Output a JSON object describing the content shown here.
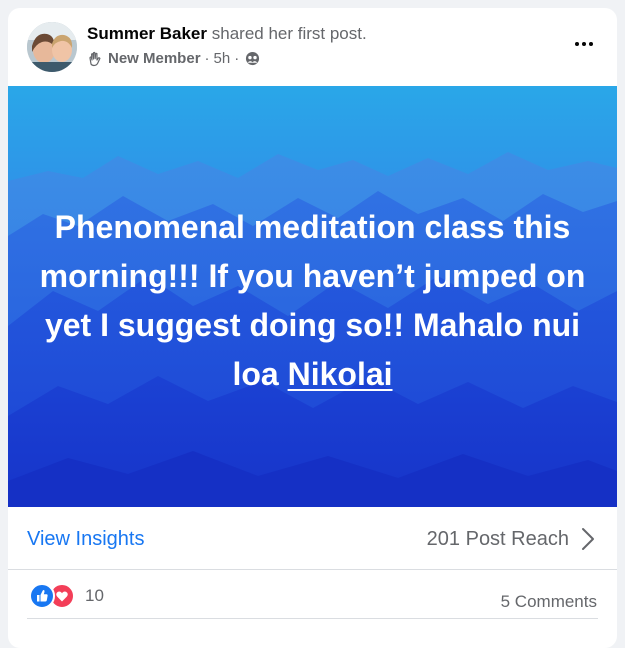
{
  "post": {
    "author": "Summer Baker",
    "action": "shared her first post.",
    "badge": "New Member",
    "time": "5h",
    "dot": "·",
    "audience_icon": "group-audience-icon",
    "badge_icon": "waving-hand-icon",
    "more_icon": "more-options-icon"
  },
  "media": {
    "text_before_link": "Phenomenal meditation class this morning!!! If you haven’t jumped on yet I suggest doing so!! Mahalo nui loa ",
    "link_text": "Nikolai",
    "background": "blue-mountains",
    "colors": {
      "sky_top": "#23a8e6",
      "sky_bottom": "#1a4fd8",
      "text": "#ffffff"
    }
  },
  "insights": {
    "view_label": "View Insights",
    "reach_label": "201 Post Reach",
    "chevron_icon": "chevron-right-icon"
  },
  "reactions": {
    "count": "10",
    "comments_label": "5 Comments",
    "icons": [
      "like-reaction-icon",
      "love-reaction-icon"
    ]
  },
  "colors": {
    "accent": "#1877f2",
    "muted": "#65676b",
    "love": "#f33e58"
  }
}
